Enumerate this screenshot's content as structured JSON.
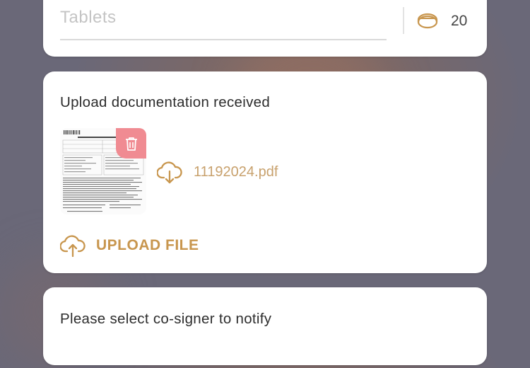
{
  "medication": {
    "unit_placeholder": "Tablets",
    "quantity": "20",
    "quantity_icon": "pill-icon"
  },
  "documentation": {
    "title": "Upload documentation received",
    "file": {
      "name": "11192024.pdf",
      "thumbnail_icon": "document-thumbnail",
      "delete_icon": "trash-icon",
      "download_icon": "cloud-download-icon"
    },
    "upload_label": "UPLOAD FILE",
    "upload_icon": "cloud-upload-icon"
  },
  "cosigner": {
    "title": "Please select co-signer to notify"
  },
  "colors": {
    "accent_gold": "#c8964e",
    "file_link": "#c8a16d",
    "delete_red": "#f08b92",
    "placeholder_gray": "#c4c4c4"
  }
}
